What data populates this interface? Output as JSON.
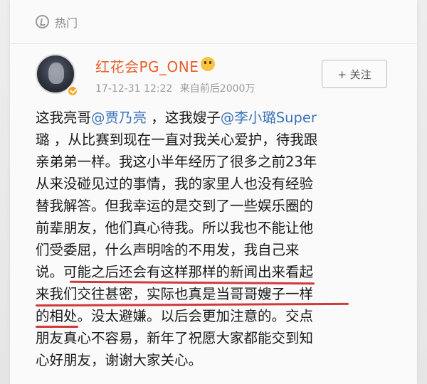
{
  "hot_bar": {
    "label": "热门"
  },
  "post": {
    "author": "红花会PG_ONE",
    "date": "17-12-31 12:22",
    "source": "来自前后2000万",
    "follow_label": "+ 关注",
    "lines": [
      {
        "pre": "这我亮哥",
        "mention": "@贾乃亮",
        "post": " ，这我嫂子",
        "mention2": "@李小璐Super"
      },
      {
        "text": "璐 ，从比赛到现在一直对我关心爱护，待我跟"
      },
      {
        "text": "亲弟弟一样。我这小半年经历了很多之前23年"
      },
      {
        "text": "从来没碰见过的事情，我的家里人也没有经验"
      },
      {
        "text": "替我解答。但我幸运的是交到了一些娱乐圈的"
      },
      {
        "text": "前辈朋友，他们真心待我。所以我也不能让他"
      },
      {
        "text": "们受委屈，什么声明啥的不用发，我自己来"
      },
      {
        "text": "说。可能之后还会有这样那样的新闻出来看起"
      },
      {
        "text": "来我们交往甚密，实际也真是当哥哥嫂子一样"
      },
      {
        "text": "的相处。没太避嫌。以后会更加注意的。交点"
      },
      {
        "text": "朋友真心不容易，新年了祝愿大家都能交到知"
      },
      {
        "text": "心好朋友，谢谢大家关心。"
      }
    ]
  },
  "colors": {
    "author": "#e8602c",
    "mention": "#3b73b9",
    "underline": "#d23a3a"
  }
}
